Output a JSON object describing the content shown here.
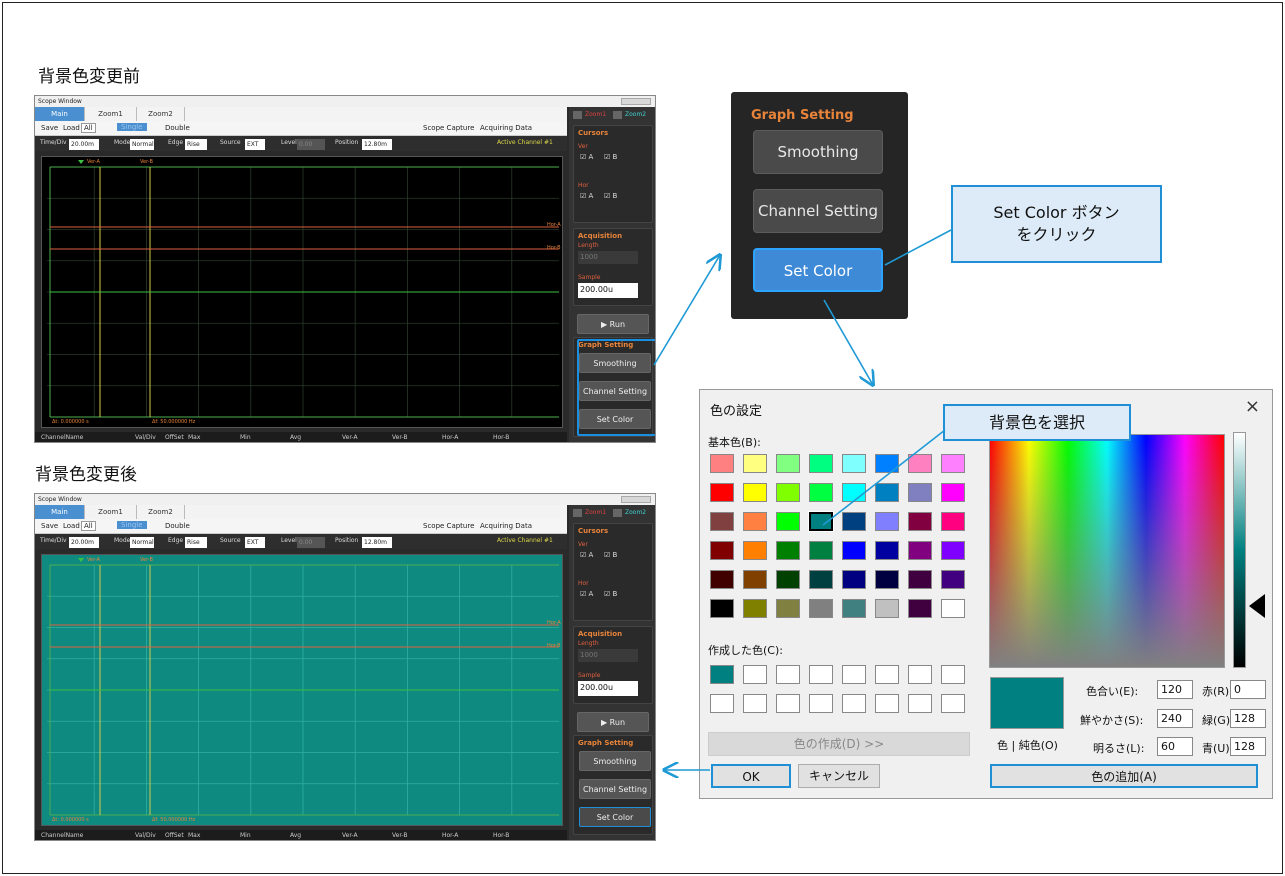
{
  "before_title": "背景色変更前",
  "after_title": "背景色変更後",
  "scope": {
    "window_title": "Scope Window",
    "tabs": [
      "Main",
      "Zoom1",
      "Zoom2"
    ],
    "toolbar": {
      "save": "Save",
      "load": "Load",
      "load_value": "All",
      "single": "Single",
      "double": "Double",
      "capture": "Scope Capture",
      "acquiring": "Acquiring Data"
    },
    "controls": {
      "timediv_label": "Time/Div",
      "timediv_value": "20.00m",
      "mode_label": "Mode",
      "mode_value": "Normal",
      "edge_label": "Edge",
      "edge_value": "Rise",
      "source_label": "Source",
      "source_value": "EXT",
      "level_label": "Level",
      "level_value": "0.00",
      "position_label": "Position",
      "position_value": "12.80m",
      "active_channel": "Active Channel #1"
    },
    "markers": {
      "ver_a": "Ver-A",
      "ver_b": "Ver-B",
      "hor_a": "Hor-A",
      "hor_b": "Hor-B",
      "dt": "Δt: 0.000000 s",
      "df": "Δf: 50.000000 Hz"
    },
    "status_cols": [
      "ChannelName",
      "Val/Div",
      "OffSet",
      "Max",
      "Min",
      "Avg",
      "Ver-A",
      "Ver-B",
      "Hor-A",
      "Hor-B"
    ],
    "side": {
      "zoom1": "Zoom1",
      "zoom2": "Zoom2",
      "cursors": "Cursors",
      "ver": "Ver",
      "hor": "Hor",
      "chk_a": "A",
      "chk_b": "B",
      "acquisition": "Acquisition",
      "length": "Length",
      "length_value": "1000",
      "sample": "Sample",
      "sample_value": "200.00u",
      "run": "Run",
      "graph_setting": "Graph Setting",
      "smoothing": "Smoothing",
      "channel_setting": "Channel Setting",
      "set_color": "Set Color"
    }
  },
  "graph_setting_zoom": {
    "title": "Graph Setting",
    "smoothing": "Smoothing",
    "channel_setting": "Channel Setting",
    "set_color": "Set Color"
  },
  "callouts": {
    "set_color": "Set Color ボタン\nをクリック",
    "bg_color": "背景色を選択"
  },
  "colors": {
    "before_bg": "#000000",
    "after_bg": "#0e8a80",
    "accent": "#1f8fd6",
    "selected": "#008080"
  },
  "dialog": {
    "title": "色の設定",
    "close": "×",
    "basic_label": "基本色(B):",
    "basic_colors": [
      "#ff8080",
      "#ffff80",
      "#80ff80",
      "#00ff80",
      "#80ffff",
      "#0080ff",
      "#ff80c0",
      "#ff80ff",
      "#ff0000",
      "#ffff00",
      "#80ff00",
      "#00ff40",
      "#00ffff",
      "#0080c0",
      "#8080c0",
      "#ff00ff",
      "#804040",
      "#ff8040",
      "#00ff00",
      "#008080",
      "#004080",
      "#8080ff",
      "#800040",
      "#ff0080",
      "#800000",
      "#ff8000",
      "#008000",
      "#008040",
      "#0000ff",
      "#0000a0",
      "#800080",
      "#8000ff",
      "#400000",
      "#804000",
      "#004000",
      "#004040",
      "#000080",
      "#000040",
      "#400040",
      "#400080",
      "#000000",
      "#808000",
      "#808040",
      "#808080",
      "#408080",
      "#c0c0c0",
      "#400040",
      "#ffffff"
    ],
    "custom_label": "作成した色(C):",
    "custom_colors": [
      "#008080",
      "#ffffff",
      "#ffffff",
      "#ffffff",
      "#ffffff",
      "#ffffff",
      "#ffffff",
      "#ffffff",
      "#ffffff",
      "#ffffff",
      "#ffffff",
      "#ffffff",
      "#ffffff",
      "#ffffff",
      "#ffffff",
      "#ffffff"
    ],
    "define_button": "色の作成(D) >>",
    "ok": "OK",
    "cancel": "キャンセル",
    "preview_label": "色 | 純色(O)",
    "hue_label": "色合い(E):",
    "hue": "120",
    "sat_label": "鮮やかさ(S):",
    "sat": "240",
    "lum_label": "明るさ(L):",
    "lum": "60",
    "red_label": "赤(R):",
    "red": "0",
    "green_label": "緑(G):",
    "green": "128",
    "blue_label": "青(U):",
    "blue": "128",
    "add_button": "色の追加(A)"
  }
}
